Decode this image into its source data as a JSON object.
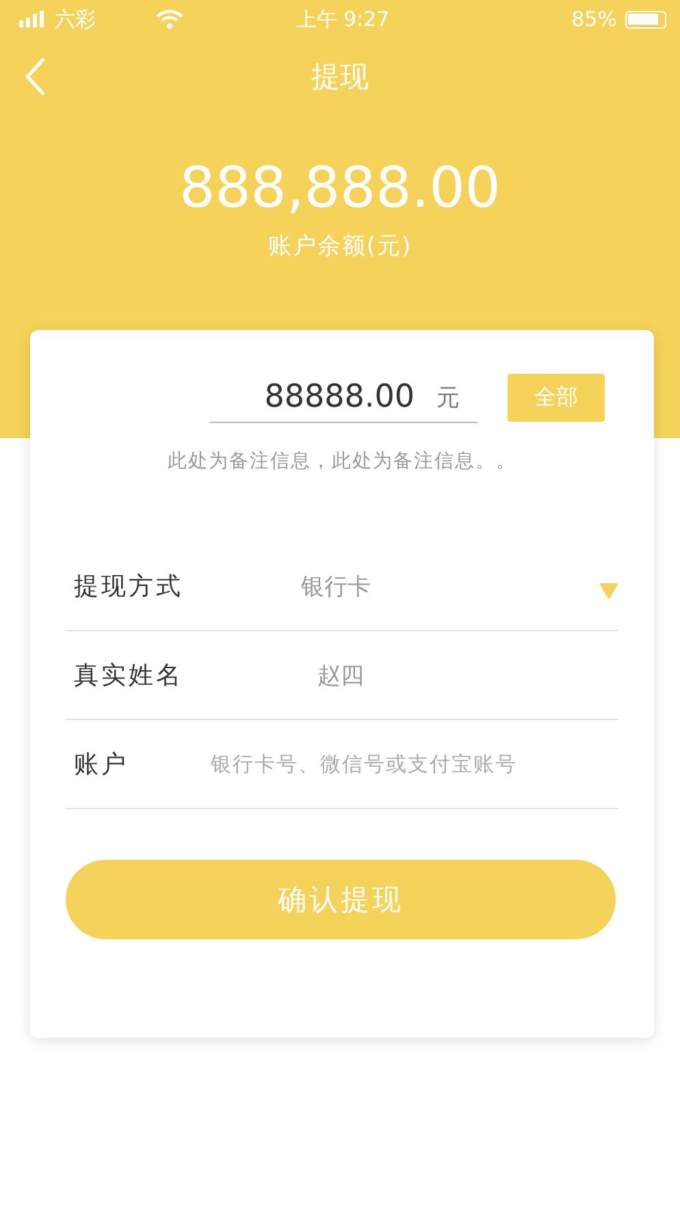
{
  "status_bar": {
    "carrier": "六彩",
    "time": "上午 9:27",
    "battery": "85%"
  },
  "nav": {
    "title": "提现"
  },
  "balance": {
    "amount": "888,888.00",
    "label": "账户余额(元)"
  },
  "amount_field": {
    "value": "88888.00",
    "unit": "元",
    "button": "全部",
    "note": "此处为备注信息，此处为备注信息。。"
  },
  "form_rows": [
    {
      "kind": "select",
      "label": "提现方式",
      "value": "银行卡"
    },
    {
      "kind": "value",
      "label": "真实姓名",
      "value": "赵四"
    },
    {
      "kind": "input",
      "label": "账户",
      "placeholder": "银行卡号、微信号或支付宝账号"
    }
  ],
  "submit_button": "确认提现"
}
